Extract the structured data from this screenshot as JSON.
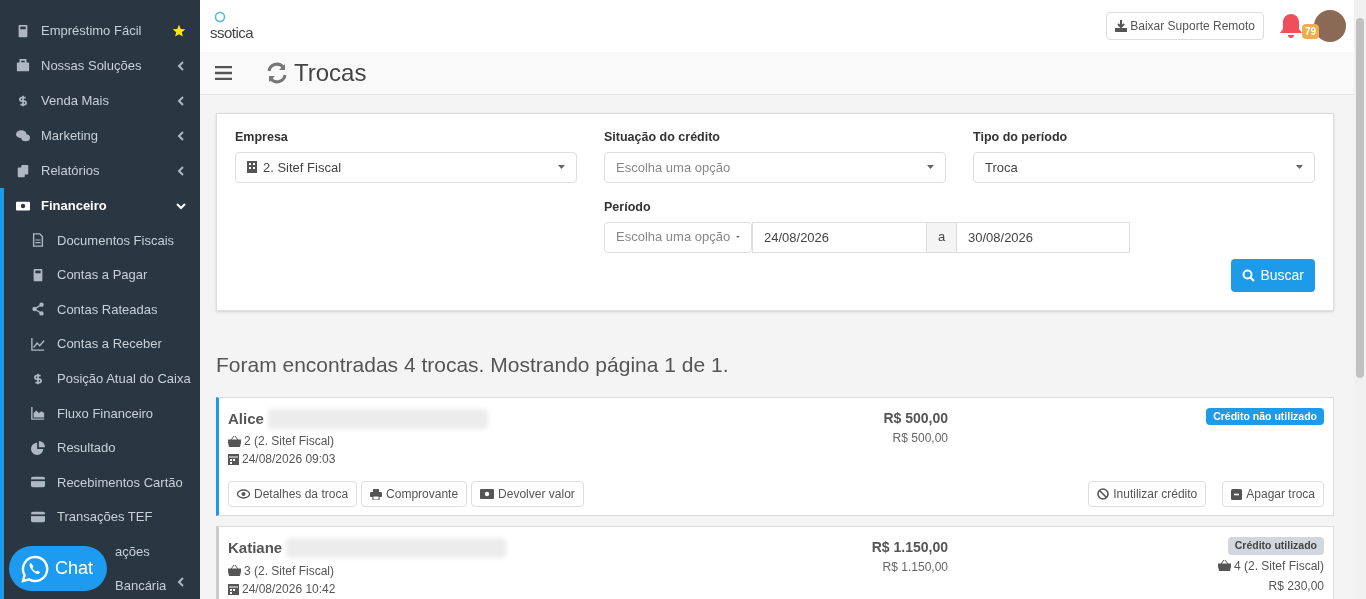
{
  "sidebar": {
    "items": [
      {
        "label": "Empréstimo Fácil",
        "selected": false
      },
      {
        "label": "Nossas Soluções",
        "expanded": false,
        "selected": false
      },
      {
        "label": "Venda Mais",
        "expanded": false,
        "selected": false
      },
      {
        "label": "Marketing",
        "expanded": false,
        "selected": false
      },
      {
        "label": "Relatórios",
        "expanded": false,
        "selected": false
      },
      {
        "label": "Financeiro",
        "expanded": true,
        "selected": true,
        "children": [
          {
            "label": "Documentos Fiscais"
          },
          {
            "label": "Contas a Pagar"
          },
          {
            "label": "Contas Rateadas"
          },
          {
            "label": "Contas a Receber"
          },
          {
            "label": "Posição Atual do Caixa"
          },
          {
            "label": "Fluxo Financeiro"
          },
          {
            "label": "Resultado"
          },
          {
            "label": "Recebimentos Cartão"
          },
          {
            "label": "Transações TEF"
          },
          {
            "label": "ações"
          },
          {
            "label": "Bancária",
            "expanded": false
          }
        ]
      }
    ]
  },
  "chat_button": "Chat",
  "header": {
    "logo": "ssotica",
    "download_button": "Baixar Suporte Remoto",
    "notifications": "79"
  },
  "page_title": "Trocas",
  "filters": {
    "empresa": {
      "label": "Empresa",
      "value": "2. Sitef Fiscal"
    },
    "situacao": {
      "label": "Situação do crédito",
      "placeholder": "Escolha uma opção"
    },
    "tipo": {
      "label": "Tipo do período",
      "value": "Troca"
    },
    "periodo": {
      "label": "Período",
      "placeholder": "Escolha uma opção",
      "start": "24/08/2026",
      "separator": "a",
      "end": "30/08/2026"
    },
    "search_button": "Buscar"
  },
  "results_summary": "Foram encontradas 4 trocas. Mostrando página 1 de 1.",
  "exchanges": [
    {
      "name": "Alice",
      "sale": "2 (2. Sitef Fiscal)",
      "date": "24/08/2026 09:03",
      "total": "R$ 500,00",
      "subtotal": "R$ 500,00",
      "status": "Crédito não utilizado",
      "credit_used": false,
      "actions": [
        "Detalhes da troca",
        "Comprovante",
        "Devolver valor"
      ],
      "right_actions": [
        "Inutilizar crédito",
        "Apagar troca"
      ]
    },
    {
      "name": "Katiane",
      "sale": "3 (2. Sitef Fiscal)",
      "date": "24/08/2026 10:42",
      "total": "R$ 1.150,00",
      "subtotal": "R$ 1.150,00",
      "status": "Crédito utilizado",
      "credit_used": true,
      "used_sale": "4 (2. Sitef Fiscal)",
      "used_value": "R$ 230,00"
    }
  ]
}
